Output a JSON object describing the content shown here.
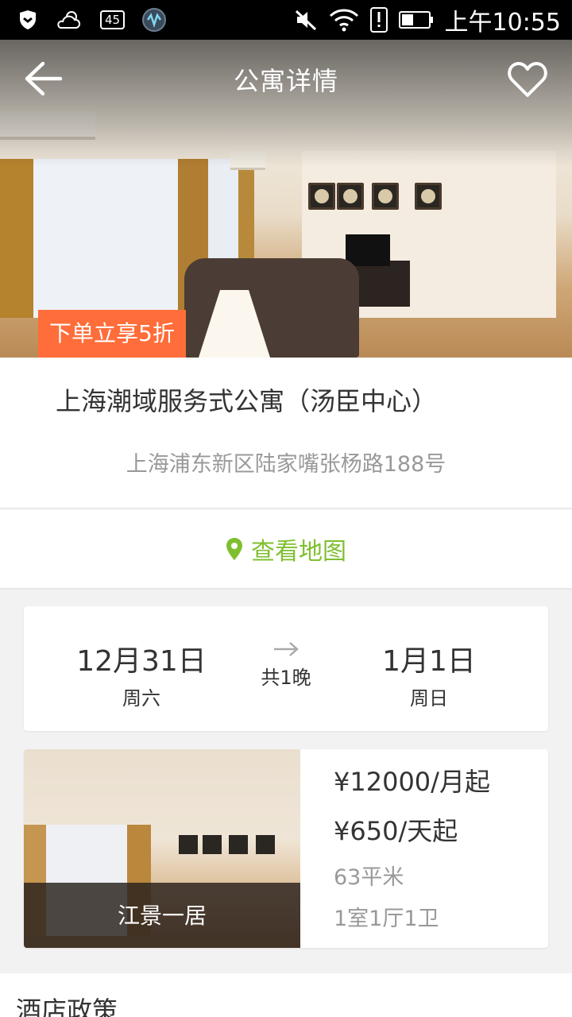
{
  "status_bar": {
    "badge": "45",
    "time": "上午10:55",
    "icons": [
      "shield-icon",
      "weather-icon",
      "notification-badge-icon",
      "app-icon",
      "mute-icon",
      "wifi-icon",
      "alert-icon",
      "battery-icon"
    ]
  },
  "header": {
    "title": "公寓详情",
    "back_icon": "arrow-left-icon",
    "favorite_icon": "heart-outline-icon"
  },
  "hero": {
    "promo": "下单立享5折"
  },
  "apartment": {
    "name": "上海潮域服务式公寓（汤臣中心）",
    "address": "上海浦东新区陆家嘴张杨路188号"
  },
  "map": {
    "label": "查看地图",
    "icon": "map-pin-icon",
    "color": "#7fbf2f"
  },
  "stay": {
    "checkin_date": "12月31日",
    "checkin_weekday": "周六",
    "nights": "共1晚",
    "checkout_date": "1月1日",
    "checkout_weekday": "周日"
  },
  "room": {
    "type": "江景一居",
    "price_month": "¥12000/月起",
    "price_day": "¥650/天起",
    "area": "63平米",
    "layout": "1室1厅1卫"
  },
  "policy": {
    "title": "酒店政策"
  },
  "colors": {
    "accent_promo": "#ff6d3a",
    "accent_map": "#7fbf2f"
  }
}
